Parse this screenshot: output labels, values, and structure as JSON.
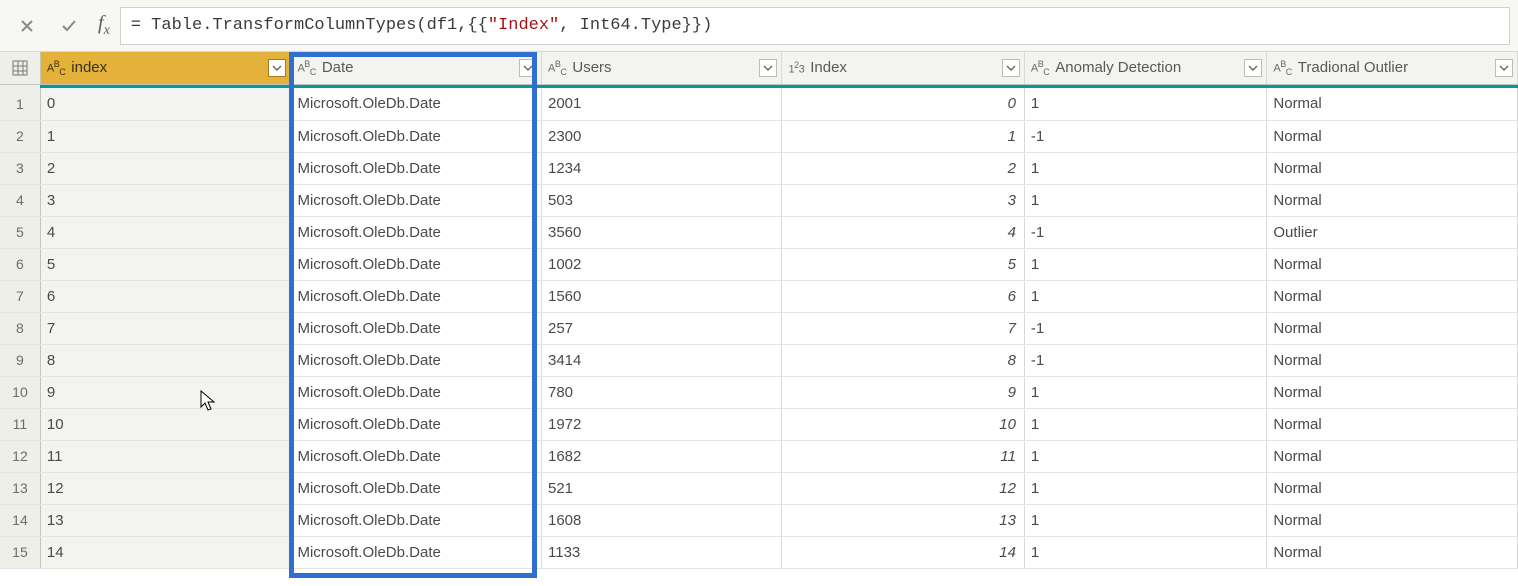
{
  "formula": {
    "prefix": "= Table.TransformColumnTypes(df1,{{",
    "literal": "\"Index\"",
    "suffix": ", Int64.Type}})"
  },
  "columns": [
    {
      "key": "index_lc",
      "label": "index",
      "typeglyph": "ABC",
      "align": "left",
      "selected": true
    },
    {
      "key": "date",
      "label": "Date",
      "typeglyph": "ABC",
      "align": "left",
      "selected": false
    },
    {
      "key": "users",
      "label": "Users",
      "typeglyph": "ABC",
      "align": "left",
      "selected": false
    },
    {
      "key": "index_num",
      "label": "Index",
      "typeglyph": "123",
      "align": "right",
      "selected": false
    },
    {
      "key": "anomaly",
      "label": "Anomaly Detection",
      "typeglyph": "ABC",
      "align": "left",
      "selected": false
    },
    {
      "key": "trad",
      "label": "Tradional Outlier",
      "typeglyph": "ABC",
      "align": "left",
      "selected": false
    }
  ],
  "rows": [
    {
      "n": "1",
      "index_lc": "0",
      "date": "Microsoft.OleDb.Date",
      "users": "2001",
      "index_num": "0",
      "anomaly": "1",
      "trad": "Normal"
    },
    {
      "n": "2",
      "index_lc": "1",
      "date": "Microsoft.OleDb.Date",
      "users": "2300",
      "index_num": "1",
      "anomaly": "-1",
      "trad": "Normal"
    },
    {
      "n": "3",
      "index_lc": "2",
      "date": "Microsoft.OleDb.Date",
      "users": "1234",
      "index_num": "2",
      "anomaly": "1",
      "trad": "Normal"
    },
    {
      "n": "4",
      "index_lc": "3",
      "date": "Microsoft.OleDb.Date",
      "users": "503",
      "index_num": "3",
      "anomaly": "1",
      "trad": "Normal"
    },
    {
      "n": "5",
      "index_lc": "4",
      "date": "Microsoft.OleDb.Date",
      "users": "3560",
      "index_num": "4",
      "anomaly": "-1",
      "trad": "Outlier"
    },
    {
      "n": "6",
      "index_lc": "5",
      "date": "Microsoft.OleDb.Date",
      "users": "1002",
      "index_num": "5",
      "anomaly": "1",
      "trad": "Normal"
    },
    {
      "n": "7",
      "index_lc": "6",
      "date": "Microsoft.OleDb.Date",
      "users": "1560",
      "index_num": "6",
      "anomaly": "1",
      "trad": "Normal"
    },
    {
      "n": "8",
      "index_lc": "7",
      "date": "Microsoft.OleDb.Date",
      "users": "257",
      "index_num": "7",
      "anomaly": "-1",
      "trad": "Normal"
    },
    {
      "n": "9",
      "index_lc": "8",
      "date": "Microsoft.OleDb.Date",
      "users": "3414",
      "index_num": "8",
      "anomaly": "-1",
      "trad": "Normal"
    },
    {
      "n": "10",
      "index_lc": "9",
      "date": "Microsoft.OleDb.Date",
      "users": "780",
      "index_num": "9",
      "anomaly": "1",
      "trad": "Normal"
    },
    {
      "n": "11",
      "index_lc": "10",
      "date": "Microsoft.OleDb.Date",
      "users": "1972",
      "index_num": "10",
      "anomaly": "1",
      "trad": "Normal"
    },
    {
      "n": "12",
      "index_lc": "11",
      "date": "Microsoft.OleDb.Date",
      "users": "1682",
      "index_num": "11",
      "anomaly": "1",
      "trad": "Normal"
    },
    {
      "n": "13",
      "index_lc": "12",
      "date": "Microsoft.OleDb.Date",
      "users": "521",
      "index_num": "12",
      "anomaly": "1",
      "trad": "Normal"
    },
    {
      "n": "14",
      "index_lc": "13",
      "date": "Microsoft.OleDb.Date",
      "users": "1608",
      "index_num": "13",
      "anomaly": "1",
      "trad": "Normal"
    },
    {
      "n": "15",
      "index_lc": "14",
      "date": "Microsoft.OleDb.Date",
      "users": "1133",
      "index_num": "14",
      "anomaly": "1",
      "trad": "Normal"
    }
  ]
}
